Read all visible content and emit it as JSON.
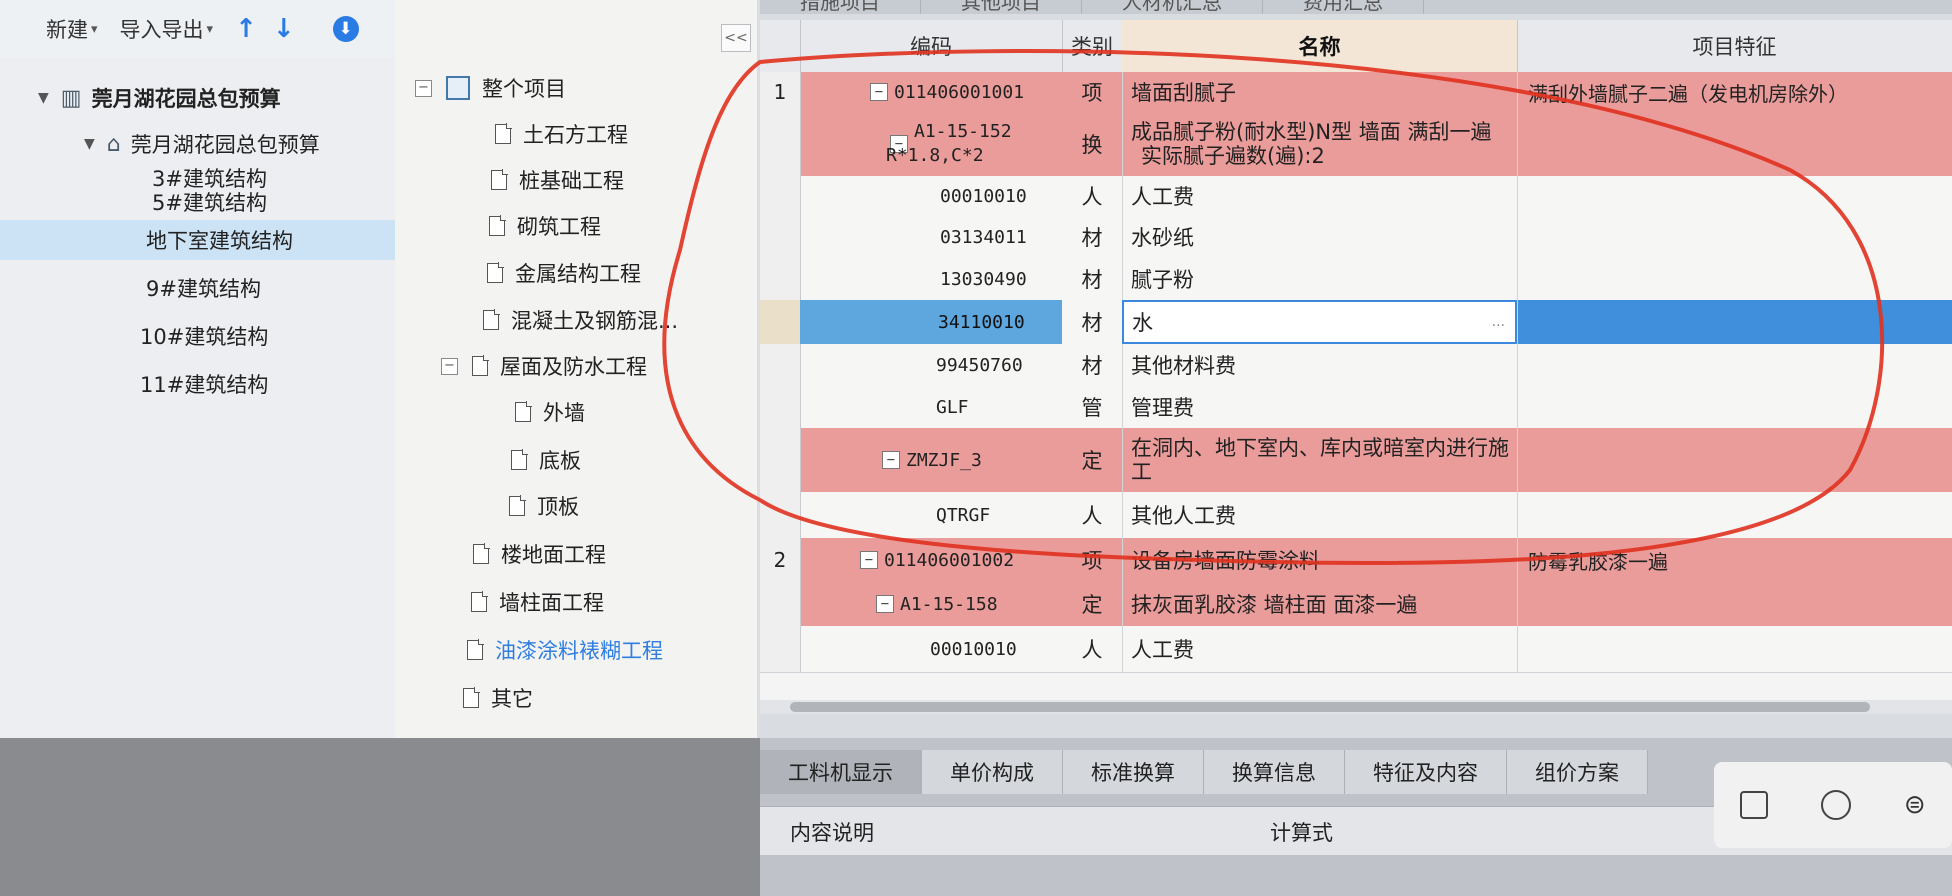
{
  "toolbar": {
    "new_label": "新建",
    "import_export_label": "导入导出",
    "up_icon": "arrow-up-icon",
    "down_icon": "arrow-down-icon",
    "download_icon": "download-icon"
  },
  "projects": {
    "root": "莞月湖花园总包预算",
    "sub": "莞月湖花园总包预算",
    "items": [
      "3#建筑结构",
      "5#建筑结构",
      "地下室建筑结构",
      "9#建筑结构",
      "10#建筑结构",
      "11#建筑结构"
    ],
    "selected": "地下室建筑结构"
  },
  "tree": {
    "collapse_label": "<<",
    "root": "整个项目",
    "items": [
      "土石方工程",
      "桩基础工程",
      "砌筑工程",
      "金属结构工程",
      "混凝土及钢筋混...",
      "屋面及防水工程",
      "外墙",
      "底板",
      "顶板",
      "楼地面工程",
      "墙柱面工程",
      "油漆涂料裱糊工程",
      "其它"
    ]
  },
  "top_tabs": [
    "措施项目",
    "其他项目",
    "人材机汇总",
    "费用汇总"
  ],
  "grid": {
    "headers": {
      "code": "编码",
      "type": "类别",
      "name": "名称",
      "feature": "项目特征"
    },
    "rows": [
      {
        "num": "1",
        "code": "011406001001",
        "type": "项",
        "name": "墙面刮腻子",
        "feature": "满刮外墙腻子二遍（发电机房除外）"
      },
      {
        "num": "",
        "code": "A1-15-152",
        "code2": "R*1.8,C*2",
        "type": "换",
        "name": "成品腻子粉(耐水型)N型 墙面 满刮一遍",
        "name2": "实际腻子遍数(遍):2",
        "feature": ""
      },
      {
        "num": "",
        "code": "00010010",
        "type": "人",
        "name": "人工费",
        "feature": ""
      },
      {
        "num": "",
        "code": "03134011",
        "type": "材",
        "name": "水砂纸",
        "feature": ""
      },
      {
        "num": "",
        "code": "13030490",
        "type": "材",
        "name": "腻子粉",
        "feature": ""
      },
      {
        "num": "",
        "code": "34110010",
        "type": "材",
        "name": "水",
        "feature": ""
      },
      {
        "num": "",
        "code": "99450760",
        "type": "材",
        "name": "其他材料费",
        "feature": ""
      },
      {
        "num": "",
        "code": "GLF",
        "type": "管",
        "name": "管理费",
        "feature": ""
      },
      {
        "num": "",
        "code": "ZMZJF_3",
        "type": "定",
        "name": "在洞内、地下室内、库内或暗室内进行施",
        "name2": "工",
        "feature": ""
      },
      {
        "num": "",
        "code": "QTRGF",
        "type": "人",
        "name": "其他人工费",
        "feature": ""
      },
      {
        "num": "2",
        "code": "011406001002",
        "type": "项",
        "name": "设备房墙面防霉涂料",
        "feature": "防霉乳胶漆一遍"
      },
      {
        "num": "",
        "code": "A1-15-158",
        "type": "定",
        "name": "抹灰面乳胶漆 墙柱面 面漆一遍",
        "feature": ""
      },
      {
        "num": "",
        "code": "00010010",
        "type": "人",
        "name": "人工费",
        "feature": ""
      }
    ],
    "ellipsis": "..."
  },
  "bottom_tabs": [
    "工料机显示",
    "单价构成",
    "标准换算",
    "换算信息",
    "特征及内容",
    "组价方案"
  ],
  "content_header": {
    "desc": "内容说明",
    "formula": "计算式"
  },
  "colors": {
    "pink_row": "#ea9c9a",
    "selection": "#3f8fdc",
    "annotation": "#e0321f"
  }
}
